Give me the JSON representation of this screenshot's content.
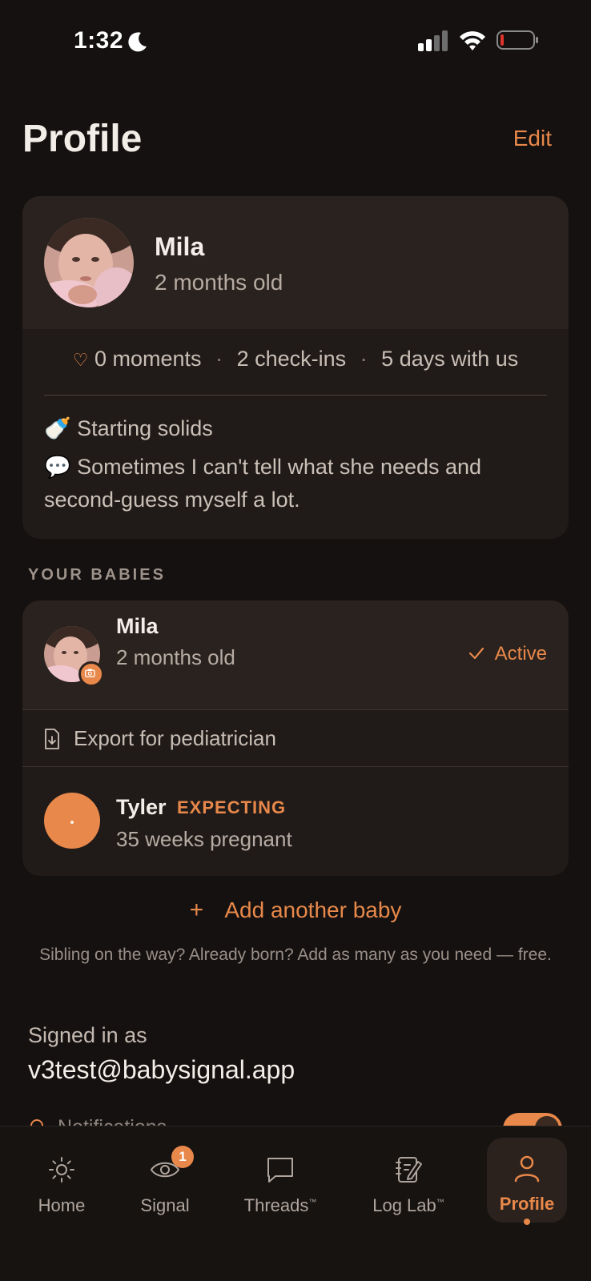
{
  "status_bar": {
    "time": "1:32"
  },
  "header": {
    "title": "Profile",
    "edit_label": "Edit"
  },
  "profile": {
    "name": "Mila",
    "age": "2 months old",
    "stats": {
      "moments": "0 moments",
      "checkins": "2 check-ins",
      "days": "5 days with us"
    },
    "notes": [
      {
        "emoji": "🍼",
        "text": "Starting solids"
      },
      {
        "emoji": "💬",
        "text": "Sometimes I can't tell what she needs and second-guess myself a lot."
      }
    ]
  },
  "babies_section": {
    "label": "YOUR BABIES",
    "babies": [
      {
        "name": "Mila",
        "subtitle": "2 months old",
        "status": "Active"
      },
      {
        "name": "Tyler",
        "badge": "EXPECTING",
        "subtitle": "35 weeks pregnant"
      }
    ],
    "export_label": "Export for pediatrician"
  },
  "add_baby": {
    "label": "Add another baby",
    "note": "Sibling on the way? Already born? Add as many as you need — free."
  },
  "account": {
    "signed_in_label": "Signed in as",
    "email": "v3test@babysignal.app"
  },
  "settings_peek": {
    "notifications_label": "Notifications",
    "notifications_on": true
  },
  "tab_bar": {
    "tabs": [
      {
        "label": "Home",
        "icon": "sun-icon"
      },
      {
        "label": "Signal",
        "icon": "eye-icon",
        "badge": "1"
      },
      {
        "label": "Threads",
        "icon": "chat-icon",
        "tm": "™"
      },
      {
        "label": "Log Lab",
        "icon": "notebook-edit-icon",
        "tm": "™"
      },
      {
        "label": "Profile",
        "icon": "person-icon",
        "active": true
      }
    ]
  },
  "colors": {
    "accent": "#e8884a",
    "background": "#141110",
    "card": "#201b19"
  }
}
